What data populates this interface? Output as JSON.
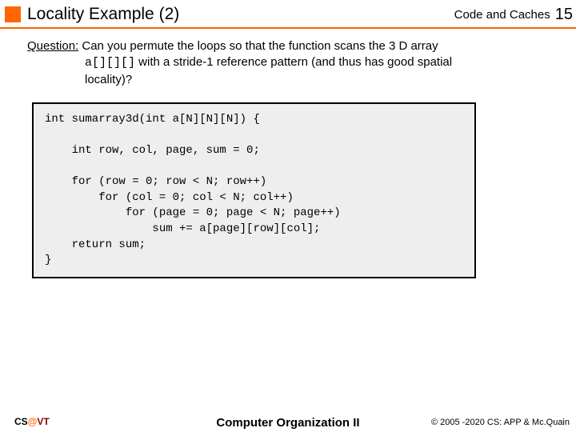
{
  "header": {
    "title": "Locality Example (2)",
    "section": "Code and Caches",
    "slide_number": "15"
  },
  "question": {
    "label": "Question:",
    "line1_rest": " Can you permute the loops so that the function scans the 3 D array",
    "line2_code": "a[][][]",
    "line2_rest": " with a stride-1 reference pattern (and thus has good spatial",
    "line3": "locality)?"
  },
  "code": "int sumarray3d(int a[N][N][N]) {\n\n    int row, col, page, sum = 0;\n\n    for (row = 0; row < N; row++)\n        for (col = 0; col < N; col++)\n            for (page = 0; page < N; page++)\n                sum += a[page][row][col];\n    return sum;\n}",
  "footer": {
    "left_cs": "CS",
    "left_at": "@",
    "left_vt": "VT",
    "center": "Computer Organization II",
    "right": "© 2005 -2020 CS: APP & Mc.Quain"
  }
}
